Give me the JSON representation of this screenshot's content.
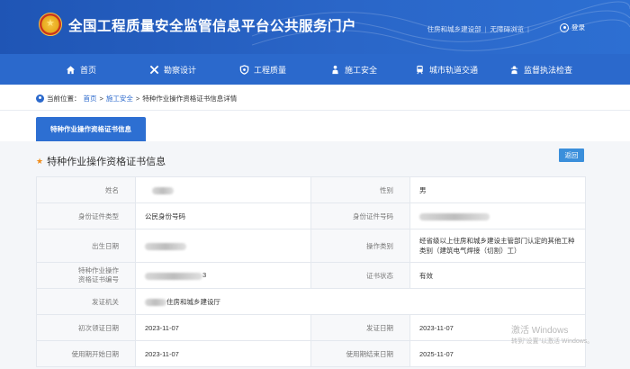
{
  "header": {
    "title": "全国工程质量安全监管信息平台公共服务门户",
    "link_ministry": "住房和城乡建设部",
    "link_separator": "|",
    "link_accessibility": "无障碍浏览",
    "login": "登录",
    "emblem_icon": "national-emblem-icon"
  },
  "nav": [
    {
      "label": "首页",
      "icon": "home-icon"
    },
    {
      "label": "勘察设计",
      "icon": "tools-icon"
    },
    {
      "label": "工程质量",
      "icon": "shield-icon"
    },
    {
      "label": "施工安全",
      "icon": "worker-icon"
    },
    {
      "label": "城市轨道交通",
      "icon": "train-icon"
    },
    {
      "label": "监督执法检查",
      "icon": "inspector-icon"
    }
  ],
  "breadcrumb": {
    "prefix": "当前位置：",
    "home": "首页",
    "sep1": ">",
    "section": "施工安全",
    "sep2": ">",
    "current": "特种作业操作资格证书信息详情"
  },
  "tab": {
    "label": "特种作业操作资格证书信息"
  },
  "section_title": "特种作业操作资格证书信息",
  "back_button": "返回",
  "info": {
    "name_label": "姓名",
    "gender_label": "性别",
    "gender_value": "男",
    "id_type_label": "身份证件类型",
    "id_type_value": "公民身份号码",
    "id_number_label": "身份证件号码",
    "birth_label": "出生日期",
    "category_label": "操作类别",
    "category_value": "经省级以上住房和城乡建设主管部门认定的其他工种类别（建筑电气焊接（切割）工）",
    "cert_no_label_1": "特种作业操作",
    "cert_no_label_2": "资格证书编号",
    "cert_no_suffix": "3",
    "status_label": "证书状态",
    "status_value": "有效",
    "issuer_label": "发证机关",
    "issuer_value": "住房和城乡建设厅",
    "first_issue_label": "初次领证日期",
    "first_issue_value": "2023-11-07",
    "issue_date_label": "发证日期",
    "issue_date_value": "2023-11-07",
    "valid_from_label": "使用期开始日期",
    "valid_from_value": "2023-11-07",
    "valid_to_label": "使用期结束日期",
    "valid_to_value": "2025-11-07"
  },
  "watermark": {
    "line1": "激活 Windows",
    "line2": "转到\"设置\"以激活 Windows。"
  },
  "colors": {
    "header_blue": "#2b69cc",
    "accent_orange": "#f08c1a",
    "button_blue": "#3b8fdb"
  }
}
